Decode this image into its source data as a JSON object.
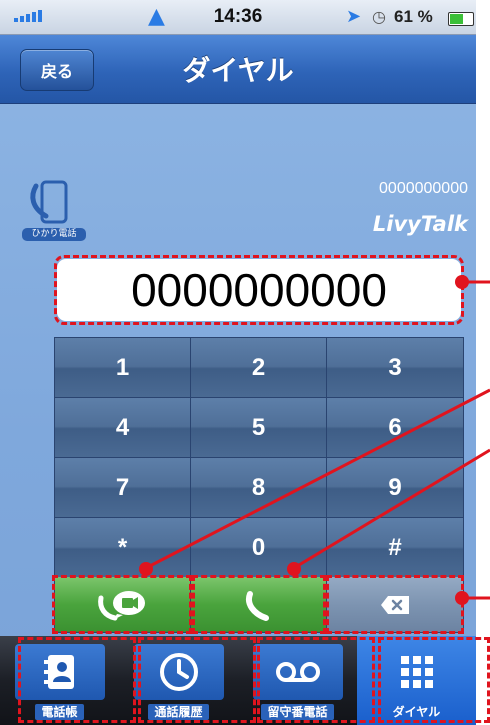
{
  "status_bar": {
    "time": "14:36",
    "battery_text": "61 %",
    "battery_level": 0.61
  },
  "nav": {
    "back_label": "戻る",
    "title": "ダイヤル"
  },
  "brand": {
    "hikari_label": "ひかり電話",
    "number": "0000000000",
    "name": "LivyTalk"
  },
  "display": {
    "number": "0000000000"
  },
  "keypad": {
    "keys": [
      "1",
      "2",
      "3",
      "4",
      "5",
      "6",
      "7",
      "8",
      "9",
      "*",
      "0",
      "#"
    ]
  },
  "actions": {
    "video_call": "video-call-icon",
    "voice_call": "phone-icon",
    "delete": "backspace-icon"
  },
  "tabs": [
    {
      "label": "電話帳",
      "icon": "contacts-icon"
    },
    {
      "label": "通話履歴",
      "icon": "clock-icon"
    },
    {
      "label": "留守番電話",
      "icon": "voicemail-icon"
    },
    {
      "label": "ダイヤル",
      "icon": "keypad-icon"
    }
  ],
  "colors": {
    "annotation": "#e0141e",
    "call_green": "#4aa43d",
    "nav_blue": "#2e64b8"
  }
}
